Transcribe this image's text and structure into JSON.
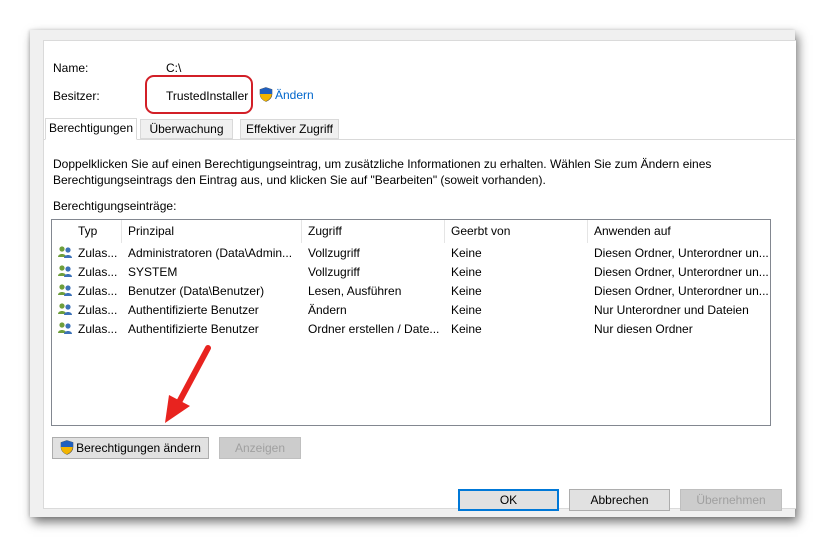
{
  "header": {
    "name_label": "Name:",
    "name_value": "C:\\",
    "owner_label": "Besitzer:",
    "owner_value": "TrustedInstaller",
    "change_link": "Ändern"
  },
  "tabs": [
    {
      "label": "Berechtigungen",
      "active": true
    },
    {
      "label": "Überwachung",
      "active": false
    },
    {
      "label": "Effektiver Zugriff",
      "active": false
    }
  ],
  "description": [
    "Doppelklicken Sie auf einen Berechtigungseintrag, um zusätzliche Informationen zu erhalten. Wählen Sie zum Ändern eines",
    "Berechtigungseintrags den Eintrag aus, und klicken Sie auf \"Bearbeiten\" (soweit vorhanden)."
  ],
  "entries_label": "Berechtigungseinträge:",
  "columns": [
    "Typ",
    "Prinzipal",
    "Zugriff",
    "Geerbt von",
    "Anwenden auf"
  ],
  "rows": [
    {
      "type": "Zulas...",
      "principal": "Administratoren (Data\\Admin...",
      "access": "Vollzugriff",
      "inherited": "Keine",
      "applies": "Diesen Ordner, Unterordner un..."
    },
    {
      "type": "Zulas...",
      "principal": "SYSTEM",
      "access": "Vollzugriff",
      "inherited": "Keine",
      "applies": "Diesen Ordner, Unterordner un..."
    },
    {
      "type": "Zulas...",
      "principal": "Benutzer (Data\\Benutzer)",
      "access": "Lesen, Ausführen",
      "inherited": "Keine",
      "applies": "Diesen Ordner, Unterordner un..."
    },
    {
      "type": "Zulas...",
      "principal": "Authentifizierte Benutzer",
      "access": "Ändern",
      "inherited": "Keine",
      "applies": "Nur Unterordner und Dateien"
    },
    {
      "type": "Zulas...",
      "principal": "Authentifizierte Benutzer",
      "access": "Ordner erstellen / Date...",
      "inherited": "Keine",
      "applies": "Nur diesen Ordner"
    }
  ],
  "buttons": {
    "change_permissions": "Berechtigungen ändern",
    "view": "Anzeigen",
    "ok": "OK",
    "cancel": "Abbrechen",
    "apply": "Übernehmen"
  },
  "icons": {
    "shield": "uac-shield-icon",
    "users": "users-icon",
    "annotation_arrow": "red-arrow"
  },
  "colors": {
    "link": "#0066cc",
    "highlight": "#d21f27",
    "arrow": "#e8231f",
    "default_button_border": "#0078d7"
  }
}
